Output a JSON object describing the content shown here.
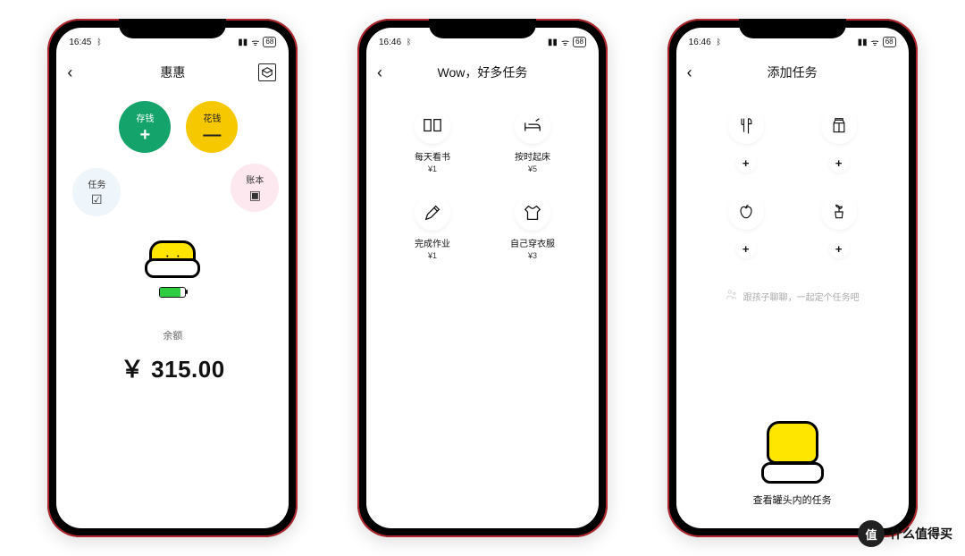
{
  "status": {
    "time1": "16:45",
    "time2": "16:46",
    "time3": "16:46",
    "bt": "✱",
    "battery": "68"
  },
  "screen1": {
    "title": "惠惠",
    "save_label": "存钱",
    "save_sign": "+",
    "spend_label": "花钱",
    "spend_sign": "—",
    "task_label": "任务",
    "ledger_label": "账本",
    "balance_label": "余额",
    "balance_amount": "￥ 315.00"
  },
  "screen2": {
    "title": "Wow，好多任务",
    "tasks": [
      {
        "name": "每天看书",
        "price": "¥1"
      },
      {
        "name": "按时起床",
        "price": "¥5"
      },
      {
        "name": "完成作业",
        "price": "¥1"
      },
      {
        "name": "自己穿衣服",
        "price": "¥3"
      }
    ]
  },
  "screen3": {
    "title": "添加任务",
    "plus": "+",
    "hint": "跟孩子聊聊，一起定个任务吧",
    "jar_caption": "查看罐头内的任务"
  },
  "watermark": {
    "badge": "值",
    "text": "什么值得买"
  }
}
